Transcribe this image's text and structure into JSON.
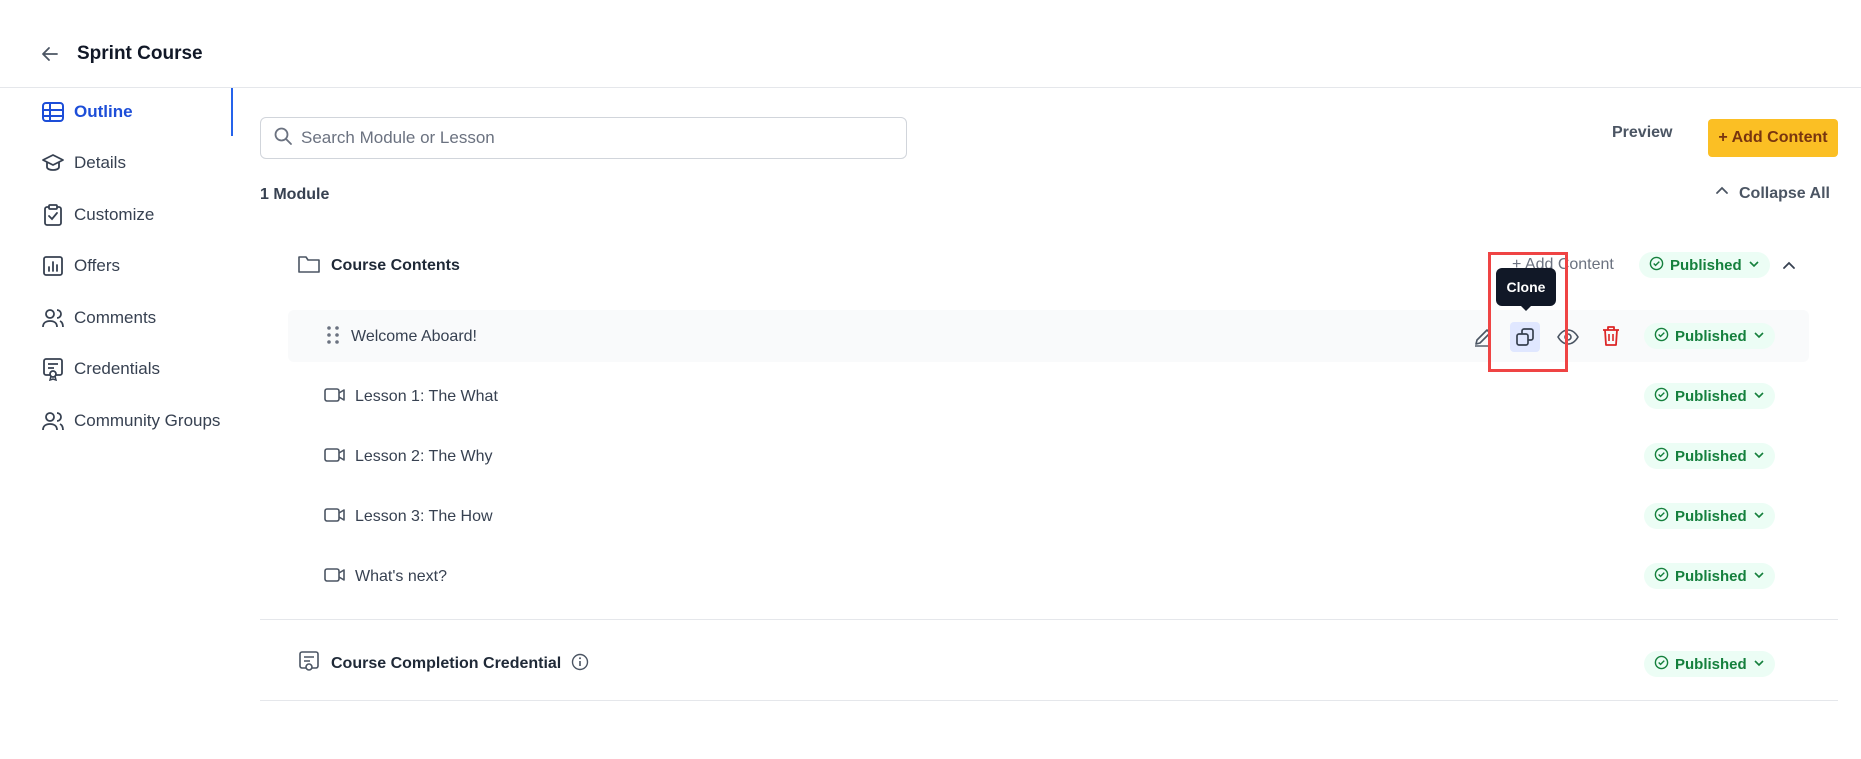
{
  "header": {
    "title": "Sprint Course"
  },
  "sidebar": {
    "items": [
      {
        "label": "Outline",
        "icon": "table-icon",
        "active": true
      },
      {
        "label": "Details",
        "icon": "graduation-cap-icon",
        "active": false
      },
      {
        "label": "Customize",
        "icon": "clipboard-check-icon",
        "active": false
      },
      {
        "label": "Offers",
        "icon": "bar-chart-icon",
        "active": false
      },
      {
        "label": "Comments",
        "icon": "users-icon",
        "active": false
      },
      {
        "label": "Credentials",
        "icon": "certificate-icon",
        "active": false
      },
      {
        "label": "Community Groups",
        "icon": "community-icon",
        "active": false
      }
    ]
  },
  "toolbar": {
    "search_placeholder": "Search Module or Lesson",
    "preview_label": "Preview",
    "add_content_label": "+ Add Content"
  },
  "outline": {
    "module_count": "1 Module",
    "collapse_all_label": "Collapse All",
    "module": {
      "title": "Course Contents",
      "add_content_label": "+ Add Content",
      "status": "Published"
    },
    "lessons": [
      {
        "title": "Welcome Aboard!",
        "icon": "drag-handle-icon",
        "status": "Published"
      },
      {
        "title": "Lesson 1: The What",
        "icon": "video-icon",
        "status": "Published"
      },
      {
        "title": "Lesson 2: The Why",
        "icon": "video-icon",
        "status": "Published"
      },
      {
        "title": "Lesson 3: The How",
        "icon": "video-icon",
        "status": "Published"
      },
      {
        "title": "What's next?",
        "icon": "video-icon",
        "status": "Published"
      }
    ],
    "credential": {
      "title": "Course Completion Credential",
      "status": "Published"
    }
  },
  "tooltip": {
    "label": "Clone"
  },
  "colors": {
    "accent": "#2563eb",
    "add_button": "#fbbf24",
    "published_text": "#15803d",
    "published_bg": "#ecfdf5",
    "delete": "#dc2626",
    "highlight": "#ef4444"
  }
}
